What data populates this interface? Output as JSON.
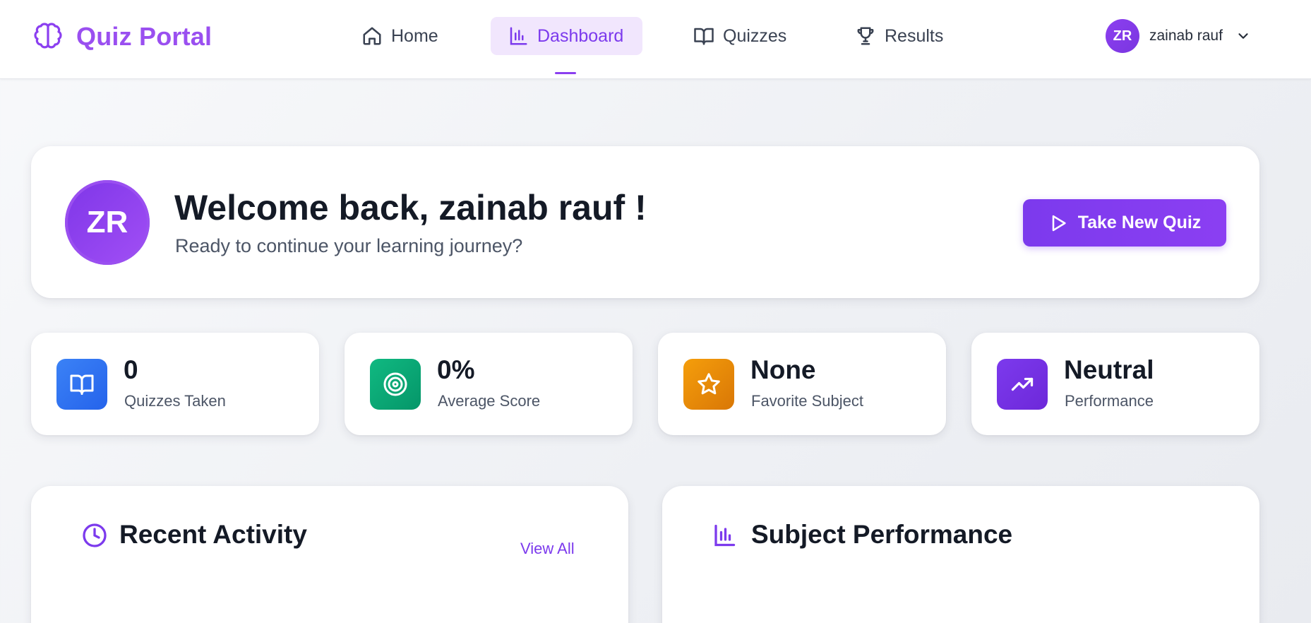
{
  "brand": {
    "name": "Quiz Portal",
    "icon": "brain-icon",
    "color": "#9a4ff0"
  },
  "nav": {
    "items": [
      {
        "label": "Home",
        "icon": "home-icon",
        "active": false
      },
      {
        "label": "Dashboard",
        "icon": "bar-chart-icon",
        "active": true
      },
      {
        "label": "Quizzes",
        "icon": "book-open-icon",
        "active": false
      },
      {
        "label": "Results",
        "icon": "trophy-icon",
        "active": false
      }
    ]
  },
  "user": {
    "initials": "ZR",
    "name": "zainab rauf"
  },
  "welcome": {
    "initials": "ZR",
    "title": "Welcome back, zainab rauf !",
    "subtitle": "Ready to continue your learning journey?",
    "cta_label": "Take New Quiz"
  },
  "stats": [
    {
      "value": "0",
      "label": "Quizzes Taken",
      "icon": "book-open-icon",
      "color": "#2563eb"
    },
    {
      "value": "0%",
      "label": "Average Score",
      "icon": "target-icon",
      "color": "#059669"
    },
    {
      "value": "None",
      "label": "Favorite Subject",
      "icon": "star-icon",
      "color": "#d97706"
    },
    {
      "value": "Neutral",
      "label": "Performance",
      "icon": "trending-up-icon",
      "color": "#6d28d9"
    }
  ],
  "recent_activity": {
    "title": "Recent Activity",
    "icon": "clock-icon",
    "view_all_label": "View All"
  },
  "subject_performance": {
    "title": "Subject Performance",
    "icon": "bar-chart-icon"
  },
  "colors": {
    "accent": "#7c3aed",
    "accent_light": "#f1e6fd"
  }
}
